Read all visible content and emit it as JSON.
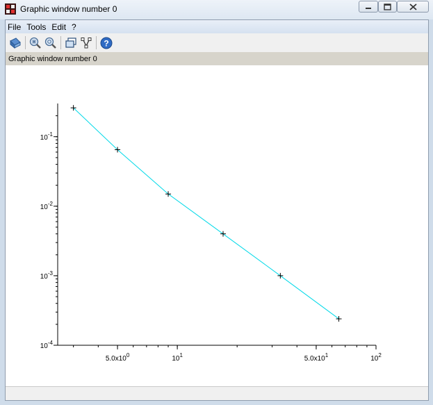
{
  "window": {
    "title": "Graphic window number 0"
  },
  "menu": {
    "items": [
      "File",
      "Tools",
      "Edit",
      "?"
    ]
  },
  "toolbar": {
    "icons": [
      "rotate-icon",
      "zoom-icon",
      "unzoom-icon",
      "datatip-icon",
      "editor-icon",
      "help-icon"
    ]
  },
  "axes_label": "Graphic window number 0",
  "colors": {
    "line": "#00d9e8",
    "marker": "#000000",
    "axes": "#000000"
  },
  "chart_data": {
    "type": "line",
    "x_scale": "log",
    "y_scale": "log",
    "xlim": [
      2.5,
      100
    ],
    "ylim": [
      0.0001,
      0.3
    ],
    "x": [
      3,
      5,
      9,
      17,
      33,
      65
    ],
    "y": [
      0.26,
      0.065,
      0.015,
      0.004,
      0.001,
      0.00024
    ],
    "marker": "+",
    "grid": false,
    "legend": "none",
    "x_ticks": [
      {
        "value": 5,
        "mantissa": "5.0x10",
        "exp": "0"
      },
      {
        "value": 10,
        "mantissa": "10",
        "exp": "1"
      },
      {
        "value": 50,
        "mantissa": "5.0x10",
        "exp": "1"
      },
      {
        "value": 100,
        "mantissa": "10",
        "exp": "2"
      }
    ],
    "y_ticks": [
      {
        "value": 0.1,
        "mantissa": "10",
        "exp": "-1"
      },
      {
        "value": 0.01,
        "mantissa": "10",
        "exp": "-2"
      },
      {
        "value": 0.001,
        "mantissa": "10",
        "exp": "-3"
      },
      {
        "value": 0.0001,
        "mantissa": "10",
        "exp": "-4"
      }
    ]
  }
}
